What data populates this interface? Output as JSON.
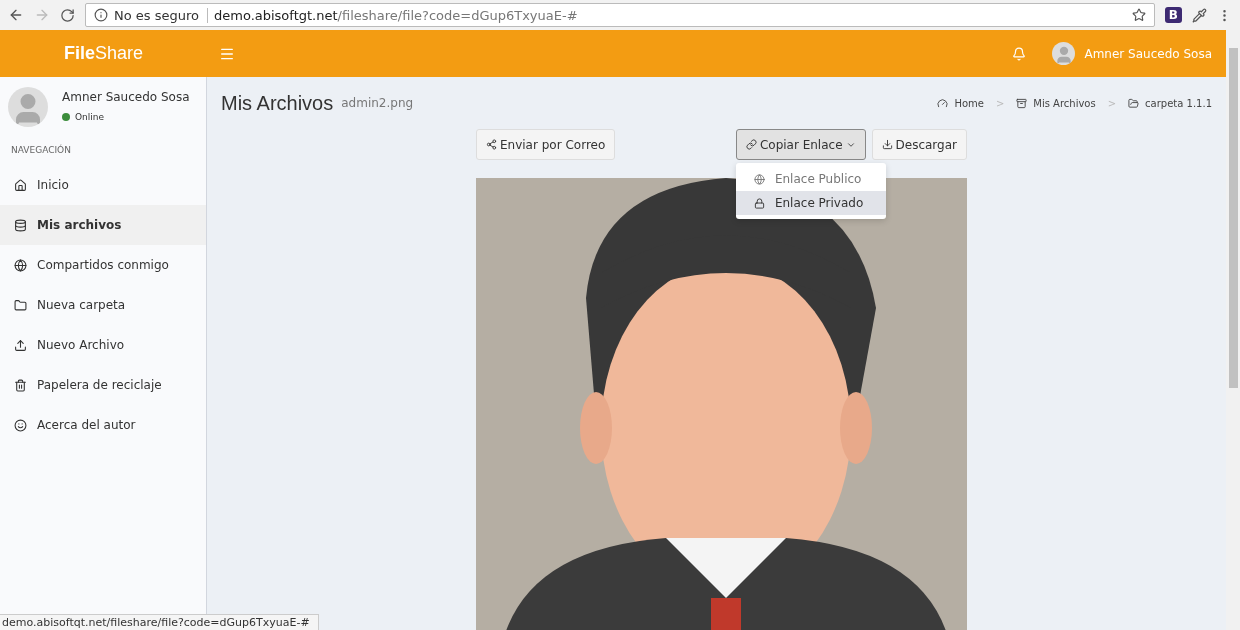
{
  "browser": {
    "security": "No es seguro",
    "url_host": "demo.abisoftgt.net",
    "url_path": "/fileshare/file?code=dGup6TxyuaE-#",
    "extension_letter": "B"
  },
  "header": {
    "brand_bold": "File",
    "brand_rest": "Share",
    "user_name": "Amner Saucedo Sosa"
  },
  "sidebar": {
    "user_name": "Amner Saucedo Sosa",
    "status": "Online",
    "section": "NAVEGACIÓN",
    "items": [
      {
        "label": "Inicio",
        "selected": false
      },
      {
        "label": "Mis archivos",
        "selected": true
      },
      {
        "label": "Compartidos conmigo",
        "selected": false
      },
      {
        "label": "Nueva carpeta",
        "selected": false
      },
      {
        "label": "Nuevo Archivo",
        "selected": false
      },
      {
        "label": "Papelera de reciclaje",
        "selected": false
      },
      {
        "label": "Acerca del autor",
        "selected": false
      }
    ]
  },
  "page": {
    "title": "Mis Archivos",
    "subtitle": "admin2.png",
    "breadcrumb": [
      {
        "label": "Home"
      },
      {
        "separator": ">",
        "label": "Mis Archivos"
      },
      {
        "separator": ">",
        "label": "carpeta 1.1.1"
      }
    ],
    "buttons": [
      {
        "label": "Enviar por Correo",
        "kind": "plain"
      },
      {
        "label": "Copiar Enlace",
        "kind": "dropdown"
      },
      {
        "label": "Descargar",
        "kind": "plain"
      }
    ],
    "dropdown_items": [
      {
        "label": "Enlace Publico",
        "selected": false
      },
      {
        "label": "Enlace Privado",
        "selected": true
      }
    ]
  },
  "status_bar": {
    "url": "demo.abisoftqt.net/fileshare/file?code=dGup6TxyuaE-#"
  }
}
